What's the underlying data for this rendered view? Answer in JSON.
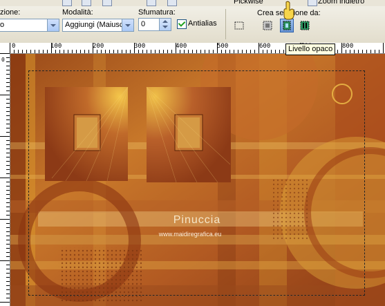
{
  "menu": {
    "pickwise_label": "Pickwise",
    "zoom_label": "Zoom indietro"
  },
  "options": {
    "mode_label": "zione:",
    "mode_value": "o",
    "modalita_label": "Modalità:",
    "modalita_value": "Aggiungi (Maiusc)",
    "sfumatura_label": "Sfumatura:",
    "sfumatura_value": "0",
    "antialias_label": "Antialias",
    "antialias_checked": true,
    "crea_sel_label": "Crea selezione da:",
    "crea_sel_buttons": [
      "Livello",
      "Livello opaco",
      "Maschera"
    ],
    "crea_sel_selected": "Livello opaco"
  },
  "tooltip": {
    "text": "Livello opaco"
  },
  "ruler": {
    "h_labels": [
      "0",
      "100",
      "200",
      "300",
      "400",
      "500",
      "600",
      "700",
      "800"
    ],
    "v_labels": [
      "0",
      "100",
      "200",
      "300",
      "400",
      "500"
    ]
  },
  "canvas": {
    "watermark_title": "Pinuccia",
    "watermark_url": "www.maidiregrafica.eu",
    "palette": {
      "dark_rust": "#8a3412",
      "rust": "#b85424",
      "amber": "#d99a28",
      "gold": "#f0c040",
      "brown": "#6d3a14"
    }
  }
}
